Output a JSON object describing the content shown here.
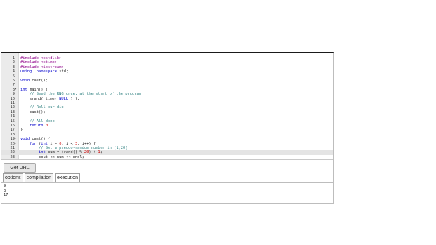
{
  "editor": {
    "active_line_index": 21,
    "lines": [
      {
        "n": "1",
        "fold": "",
        "segs": [
          [
            "pre",
            "#include <cstdlib>"
          ]
        ]
      },
      {
        "n": "2",
        "fold": "",
        "segs": [
          [
            "pre",
            "#include <ctime>"
          ]
        ]
      },
      {
        "n": "3",
        "fold": "",
        "segs": [
          [
            "pre",
            "#include <iostream>"
          ]
        ]
      },
      {
        "n": "4",
        "fold": "",
        "segs": [
          [
            "kw",
            "using"
          ],
          [
            "",
            "  "
          ],
          [
            "kw",
            "namespace"
          ],
          [
            "",
            " std;"
          ]
        ]
      },
      {
        "n": "5",
        "fold": "",
        "segs": []
      },
      {
        "n": "6",
        "fold": "",
        "segs": [
          [
            "typ",
            "void"
          ],
          [
            "",
            " cast();"
          ]
        ]
      },
      {
        "n": "7",
        "fold": "",
        "segs": []
      },
      {
        "n": "8",
        "fold": "▾",
        "segs": [
          [
            "typ",
            "int"
          ],
          [
            "",
            " main() {"
          ]
        ]
      },
      {
        "n": "9",
        "fold": "",
        "segs": [
          [
            "",
            "    "
          ],
          [
            "com",
            "// Seed the RNG once, at the start of the program"
          ]
        ]
      },
      {
        "n": "10",
        "fold": "",
        "segs": [
          [
            "",
            "    srand( time( "
          ],
          [
            "kw",
            "NULL"
          ],
          [
            "",
            " ) );"
          ]
        ]
      },
      {
        "n": "11",
        "fold": "",
        "segs": []
      },
      {
        "n": "12",
        "fold": "",
        "segs": [
          [
            "",
            "    "
          ],
          [
            "com",
            "// Roll our die"
          ]
        ]
      },
      {
        "n": "13",
        "fold": "",
        "segs": [
          [
            "",
            "    cast();"
          ]
        ]
      },
      {
        "n": "14",
        "fold": "",
        "segs": []
      },
      {
        "n": "15",
        "fold": "",
        "segs": [
          [
            "",
            "    "
          ],
          [
            "com",
            "// All done"
          ]
        ]
      },
      {
        "n": "16",
        "fold": "",
        "segs": [
          [
            "",
            "    "
          ],
          [
            "kw",
            "return"
          ],
          [
            "",
            " "
          ],
          [
            "num",
            "0"
          ],
          [
            "",
            ";"
          ]
        ]
      },
      {
        "n": "17",
        "fold": "",
        "segs": [
          [
            "",
            "}"
          ]
        ]
      },
      {
        "n": "18",
        "fold": "",
        "segs": []
      },
      {
        "n": "19",
        "fold": "▾",
        "segs": [
          [
            "typ",
            "void"
          ],
          [
            "",
            " cast() {"
          ]
        ]
      },
      {
        "n": "20",
        "fold": "▾",
        "segs": [
          [
            "",
            "    "
          ],
          [
            "kw",
            "for"
          ],
          [
            "",
            " ("
          ],
          [
            "typ",
            "int"
          ],
          [
            "",
            " i = "
          ],
          [
            "num",
            "0"
          ],
          [
            "",
            "; i < "
          ],
          [
            "num",
            "3"
          ],
          [
            "",
            "; i++) {"
          ]
        ]
      },
      {
        "n": "21",
        "fold": "",
        "segs": [
          [
            "",
            "        "
          ],
          [
            "com",
            "// Get a pseudo-random number in [1,20]"
          ]
        ]
      },
      {
        "n": "22",
        "fold": "",
        "segs": [
          [
            "",
            "        "
          ],
          [
            "typ",
            "int"
          ],
          [
            "",
            " num = (rand() % "
          ],
          [
            "num",
            "20"
          ],
          [
            "",
            ") + "
          ],
          [
            "num",
            "1"
          ],
          [
            "",
            ";"
          ]
        ]
      },
      {
        "n": "23",
        "fold": "",
        "segs": [
          [
            "",
            "        cout << num << endl;"
          ]
        ]
      }
    ]
  },
  "buttons": {
    "get_url": "Get URL"
  },
  "tabs": [
    {
      "label": "options",
      "selected": false
    },
    {
      "label": "compilation",
      "selected": false
    },
    {
      "label": "execution",
      "selected": true
    }
  ],
  "output": [
    "9",
    "3",
    "17"
  ]
}
